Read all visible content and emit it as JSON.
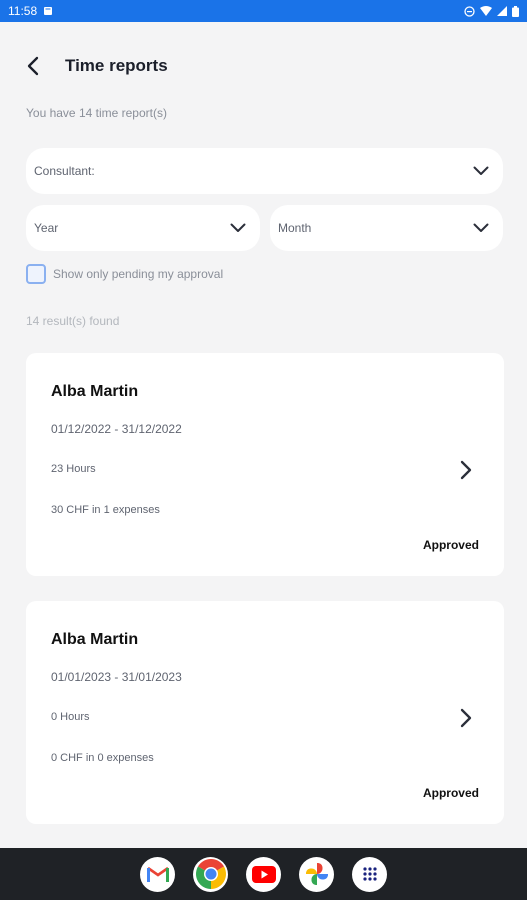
{
  "status_bar": {
    "time": "11:58"
  },
  "header": {
    "title": "Time reports"
  },
  "summary": {
    "count_text": "You have 14 time report(s)",
    "results_text": "14 result(s) found"
  },
  "filters": {
    "consultant_label": "Consultant:",
    "year_label": "Year",
    "month_label": "Month",
    "pending_label": "Show only pending my approval",
    "pending_checked": false
  },
  "reports": [
    {
      "name": "Alba Martin",
      "range": "01/12/2022 - 31/12/2022",
      "hours": "23 Hours",
      "expenses": "30 CHF in 1 expenses",
      "status": "Approved"
    },
    {
      "name": "Alba Martin",
      "range": "01/01/2023 - 31/01/2023",
      "hours": "0 Hours",
      "expenses": "0 CHF in 0 expenses",
      "status": "Approved"
    }
  ],
  "dock": [
    "gmail-icon",
    "chrome-icon",
    "youtube-icon",
    "photos-icon",
    "app-drawer-icon"
  ],
  "colors": {
    "status_bar": "#1a73e8",
    "background": "#f4f4f5",
    "checkbox_border": "#8ab0f0",
    "nav_bar": "#1f2226"
  }
}
